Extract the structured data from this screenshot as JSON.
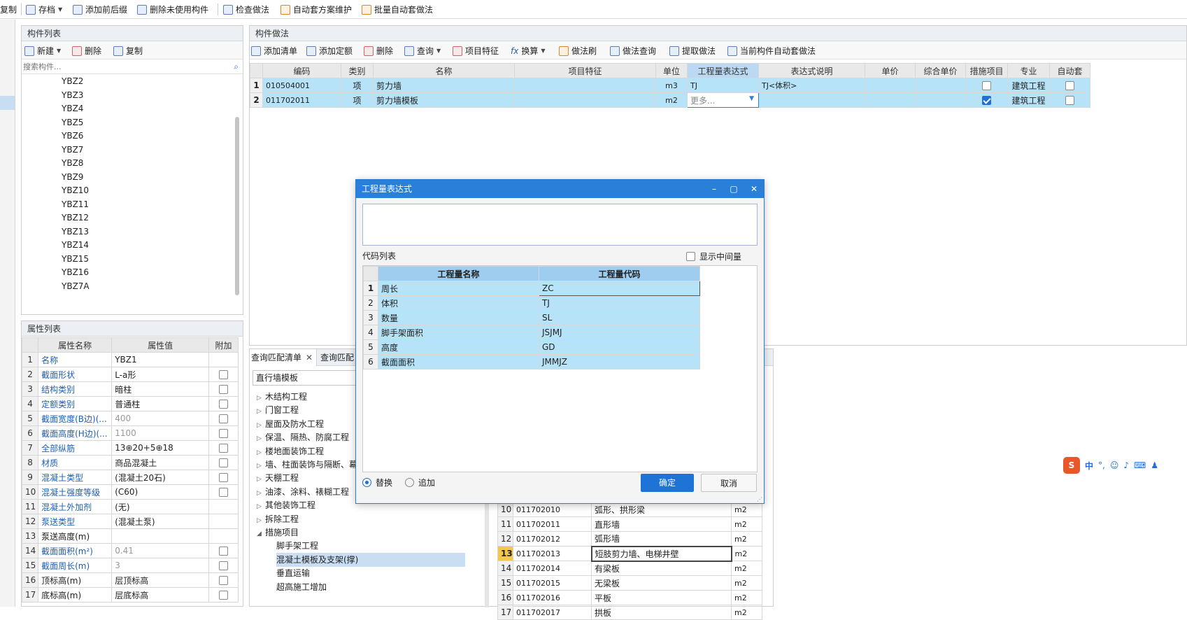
{
  "toolbar": {
    "copy": "复制",
    "save": "存档",
    "add_prefix": "添加前后缀",
    "delete_unused": "删除未使用构件",
    "check": "检查做法",
    "auto_maintain": "自动套方案维护",
    "batch_auto": "批量自动套做法"
  },
  "component_list": {
    "title": "构件列表",
    "new": "新建",
    "delete": "删除",
    "copy": "复制",
    "search_placeholder": "搜索构件...",
    "items": [
      "YBZ2",
      "YBZ3",
      "YBZ4",
      "YBZ5",
      "YBZ6",
      "YBZ7",
      "YBZ8",
      "YBZ9",
      "YBZ10",
      "YBZ11",
      "YBZ12",
      "YBZ13",
      "YBZ14",
      "YBZ15",
      "YBZ16",
      "YBZ7A"
    ]
  },
  "attr_list": {
    "title": "属性列表",
    "headers": [
      "属性名称",
      "属性值",
      "附加"
    ],
    "rows": [
      {
        "n": "1",
        "name": "名称",
        "value": "YBZ1",
        "chk": false,
        "nochk": true
      },
      {
        "n": "2",
        "name": "截面形状",
        "value": "L-a形",
        "chk": false
      },
      {
        "n": "3",
        "name": "结构类别",
        "value": "暗柱",
        "chk": false
      },
      {
        "n": "4",
        "name": "定额类别",
        "value": "普通柱",
        "chk": false
      },
      {
        "n": "5",
        "name": "截面宽度(B边)(...",
        "value": "400",
        "chk": false,
        "gray": true
      },
      {
        "n": "6",
        "name": "截面高度(H边)(...",
        "value": "1100",
        "chk": false,
        "gray": true
      },
      {
        "n": "7",
        "name": "全部纵筋",
        "value": "13⊕20+5⊕18",
        "chk": false
      },
      {
        "n": "8",
        "name": "材质",
        "value": "商品混凝土",
        "chk": false
      },
      {
        "n": "9",
        "name": "混凝土类型",
        "value": "(混凝土20石)",
        "chk": false
      },
      {
        "n": "10",
        "name": "混凝土强度等级",
        "value": "(C60)",
        "chk": false
      },
      {
        "n": "11",
        "name": "混凝土外加剂",
        "value": "(无)",
        "chk": false,
        "nochk": true
      },
      {
        "n": "12",
        "name": "泵送类型",
        "value": "(混凝土泵)",
        "chk": false,
        "nochk": true
      },
      {
        "n": "13",
        "name": "泵送高度(m)",
        "value": "",
        "chk": false,
        "nochk": true,
        "black": true
      },
      {
        "n": "14",
        "name": "截面面积(m²)",
        "value": "0.41",
        "chk": false,
        "gray": true
      },
      {
        "n": "15",
        "name": "截面周长(m)",
        "value": "3",
        "chk": false,
        "gray": true
      },
      {
        "n": "16",
        "name": "顶标高(m)",
        "value": "层顶标高",
        "chk": false,
        "black": true
      },
      {
        "n": "17",
        "name": "底标高(m)",
        "value": "层底标高",
        "chk": false,
        "black": true
      }
    ]
  },
  "method": {
    "title": "构件做法",
    "tools": [
      "添加清单",
      "添加定额",
      "删除",
      "查询",
      "项目特征",
      "换算",
      "做法刷",
      "做法查询",
      "提取做法",
      "当前构件自动套做法"
    ],
    "headers": [
      "编码",
      "类别",
      "名称",
      "项目特征",
      "单位",
      "工程量表达式",
      "表达式说明",
      "单价",
      "综合单价",
      "措施项目",
      "专业",
      "自动套"
    ],
    "rows": [
      {
        "n": "1",
        "code": "010504001",
        "type": "项",
        "name": "剪力墙",
        "feature": "",
        "unit": "m3",
        "expr": "TJ",
        "desc": "TJ<体积>",
        "price": "",
        "total": "",
        "measure": false,
        "major": "建筑工程",
        "auto": false
      },
      {
        "n": "2",
        "code": "011702011",
        "type": "项",
        "name": "剪力墙模板",
        "feature": "",
        "unit": "m2",
        "expr": "更多...",
        "desc": "",
        "price": "",
        "total": "",
        "measure": true,
        "major": "建筑工程",
        "auto": false
      }
    ]
  },
  "bottom_tabs": [
    "查询匹配清单",
    "查询匹配"
  ],
  "query": {
    "select": "直行墙模板",
    "tree": [
      {
        "label": "木结构工程",
        "level": 0,
        "open": false
      },
      {
        "label": "门窗工程",
        "level": 0,
        "open": false
      },
      {
        "label": "屋面及防水工程",
        "level": 0,
        "open": false
      },
      {
        "label": "保温、隔热、防腐工程",
        "level": 0,
        "open": false
      },
      {
        "label": "楼地面装饰工程",
        "level": 0,
        "open": false
      },
      {
        "label": "墙、柱面装饰与隔断、幕",
        "level": 0,
        "open": false
      },
      {
        "label": "天棚工程",
        "level": 0,
        "open": false
      },
      {
        "label": "油漆、涂料、裱糊工程",
        "level": 0,
        "open": false
      },
      {
        "label": "其他装饰工程",
        "level": 0,
        "open": false
      },
      {
        "label": "拆除工程",
        "level": 0,
        "open": false
      },
      {
        "label": "措施项目",
        "level": 0,
        "open": true
      },
      {
        "label": "脚手架工程",
        "level": 1
      },
      {
        "label": "混凝土模板及支架(撑)",
        "level": 1,
        "selected": true
      },
      {
        "label": "垂直运输",
        "level": 1
      },
      {
        "label": "超高施工增加",
        "level": 1
      }
    ],
    "results": [
      {
        "n": "10",
        "code": "011702010",
        "name": "弧形、拱形梁",
        "unit": "m2"
      },
      {
        "n": "11",
        "code": "011702011",
        "name": "直形墙",
        "unit": "m2"
      },
      {
        "n": "12",
        "code": "011702012",
        "name": "弧形墙",
        "unit": "m2"
      },
      {
        "n": "13",
        "code": "011702013",
        "name": "短肢剪力墙、电梯井壁",
        "unit": "m2",
        "selected": true
      },
      {
        "n": "14",
        "code": "011702014",
        "name": "有梁板",
        "unit": "m2"
      },
      {
        "n": "15",
        "code": "011702015",
        "name": "无梁板",
        "unit": "m2"
      },
      {
        "n": "16",
        "code": "011702016",
        "name": "平板",
        "unit": "m2"
      },
      {
        "n": "17",
        "code": "011702017",
        "name": "拱板",
        "unit": "m2"
      }
    ]
  },
  "dialog": {
    "title": "工程量表达式",
    "input_value": "",
    "code_list_label": "代码列表",
    "show_intermediate": "显示中间量",
    "headers": [
      "工程量名称",
      "工程量代码"
    ],
    "rows": [
      {
        "n": "1",
        "name": "周长",
        "code": "ZC"
      },
      {
        "n": "2",
        "name": "体积",
        "code": "TJ"
      },
      {
        "n": "3",
        "name": "数量",
        "code": "SL"
      },
      {
        "n": "4",
        "name": "脚手架面积",
        "code": "JSJMJ"
      },
      {
        "n": "5",
        "name": "高度",
        "code": "GD"
      },
      {
        "n": "6",
        "name": "截面面积",
        "code": "JMMJZ"
      }
    ],
    "replace": "替换",
    "append": "追加",
    "ok": "确定",
    "cancel": "取消"
  },
  "ime": {
    "brand": "S",
    "lang": "中",
    "punct": "°,"
  },
  "colors": {
    "accent": "#2a7fd9",
    "selection": "#b6e3f7",
    "link": "#1f5fb3"
  }
}
